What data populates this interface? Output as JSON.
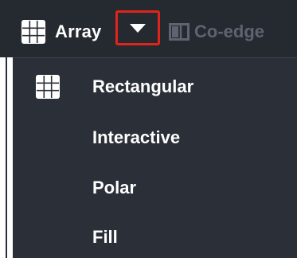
{
  "toolbar": {
    "array_label": "Array",
    "array_icon": "grid-icon",
    "dropdown_icon": "caret-down-icon",
    "coedge_label": "Co-edge",
    "coedge_icon": "co-edge-icon"
  },
  "menu": {
    "items": [
      {
        "label": "Rectangular",
        "icon": "grid-icon"
      },
      {
        "label": "Interactive",
        "icon": ""
      },
      {
        "label": "Polar",
        "icon": ""
      },
      {
        "label": "Fill",
        "icon": ""
      }
    ]
  },
  "colors": {
    "toolbar_bg": "#252a31",
    "menu_bg": "#2b3038",
    "highlight_border": "#e0231b",
    "text": "#ffffff",
    "disabled_text": "#5d6470"
  }
}
